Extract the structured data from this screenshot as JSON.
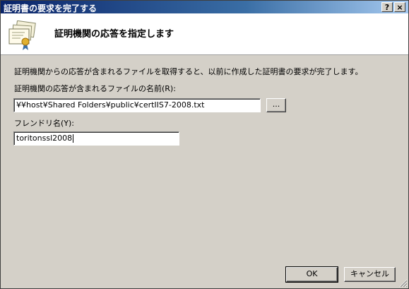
{
  "window": {
    "title": "証明書の要求を完了する",
    "help_label": "?",
    "close_label": "×"
  },
  "header": {
    "title": "証明機関の応答を指定します",
    "icon": "certificate-icon"
  },
  "body": {
    "description": "証明機関からの応答が含まれるファイルを取得すると、以前に作成した証明書の要求が完了します。",
    "file_label": "証明機関の応答が含まれるファイルの名前(R):",
    "file_value": "¥¥host¥Shared Folders¥public¥certIIS7-2008.txt",
    "browse_label": "...",
    "friendly_label": "フレンドリ名(Y):",
    "friendly_value": "toritonssl2008"
  },
  "buttons": {
    "ok": "OK",
    "cancel": "キャンセル"
  }
}
